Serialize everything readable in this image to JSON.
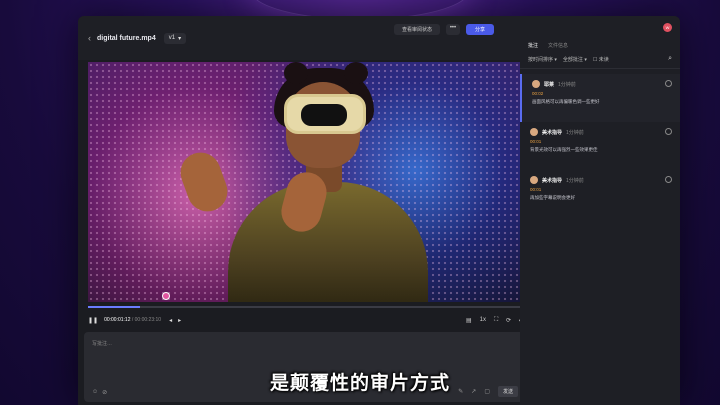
{
  "header": {
    "back_icon": "chevron-left-icon",
    "file_title": "digital future.mp4",
    "version": "v1",
    "btn_preview": "查看审阅状态",
    "btn_more": "•••",
    "btn_share": "分享"
  },
  "player": {
    "progress_fraction": 0.12,
    "current_time": "00:00:01:12",
    "total_time": "00:00:23:10",
    "speed": "1x",
    "comment_marker_fraction": 0.18
  },
  "comment_input": {
    "placeholder": "写批注…",
    "send_label": "发送"
  },
  "panel": {
    "avatar_initials": "W",
    "tabs": [
      "批注",
      "文件信息"
    ],
    "filter_sort": "按时间排序",
    "filter_all": "全部批注",
    "filter_checkbox": "未读",
    "comments": [
      {
        "name": "耶莱",
        "time": "1分钟前",
        "ts": "00:02",
        "text": "画面风格可以再偏暖色调一些更好"
      },
      {
        "name": "美术指导",
        "time": "1分钟前",
        "ts": "00:01",
        "text": "背景光效可以再强烈一些效果更佳"
      },
      {
        "name": "美术指导",
        "time": "1分钟前",
        "ts": "00:01",
        "text": "再加些字幕说明会更好"
      }
    ]
  },
  "subtitle": "是颠覆性的审片方式",
  "colors": {
    "accent": "#4a5ae8",
    "marker": "#e056a0",
    "timestamp": "#e8a040"
  }
}
